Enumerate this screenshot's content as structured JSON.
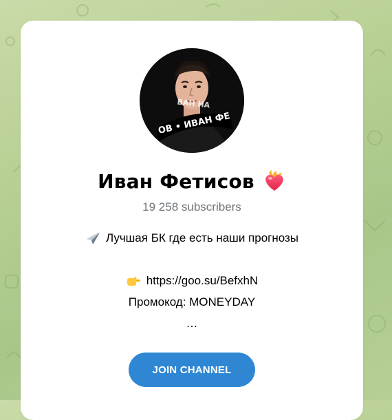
{
  "channel": {
    "name": "Иван Фетисов",
    "subscribers": "19 258 subscribers",
    "avatar_band_text": "ОВ • ИВАН ФЕ",
    "avatar_band_text_top": "ВАН НА"
  },
  "description": {
    "line1": "Лучшая БК где есть наши прогнозы",
    "link": "https://goo.su/BefxhN",
    "promo": "Промокод: MONEYDAY",
    "ellipsis": "…"
  },
  "actions": {
    "join_label": "JOIN CHANNEL"
  },
  "icons": {
    "heart": "fire-heart-icon",
    "airplane": "airplane-icon",
    "pointer": "pointing-hand-icon"
  },
  "colors": {
    "accent": "#2f87d4",
    "muted_text": "#707579",
    "background": "#b7cf93"
  }
}
